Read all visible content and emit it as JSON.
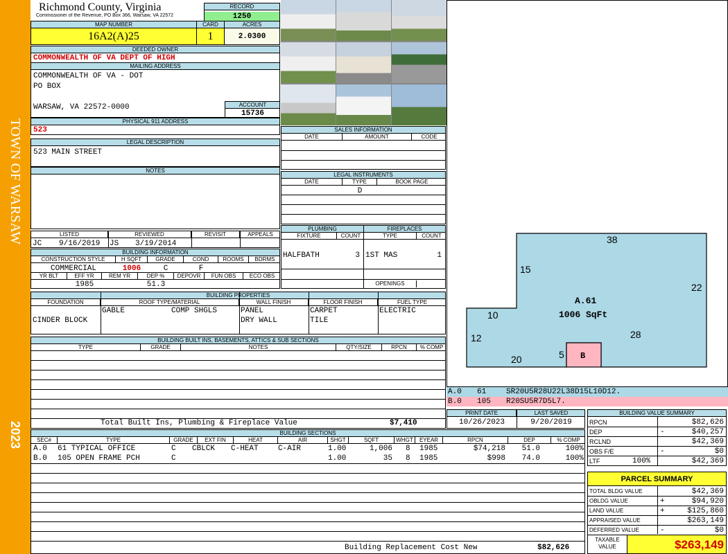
{
  "side_banner": {
    "town": "TOWN OF WARSAW",
    "year": "2023",
    "color": "#f5a000"
  },
  "header": {
    "county": "Richmond County, Virginia",
    "commissioner": "Commissioner of the Revenue, PO Box 366, Warsaw, VA 22572",
    "record_label": "RECORD",
    "record": "1250",
    "map_number_label": "MAP NUMBER",
    "map_number": "16A2(A)25",
    "card_label": "CARD",
    "card": "1",
    "acres_label": "ACRES",
    "acres": "2.0300"
  },
  "owner": {
    "label": "DEEDED OWNER",
    "value": "COMMONWEALTH OF VA DEPT OF HIGH"
  },
  "mailing": {
    "label": "MAILING ADDRESS",
    "line1": "COMMONWEALTH OF VA - DOT",
    "line2": "PO BOX",
    "line3": "WARSAW, VA 22572-0000",
    "account_label": "ACCOUNT",
    "account": "15736"
  },
  "physical": {
    "label": "PHYSICAL 911 ADDRESS",
    "value": "523"
  },
  "legal": {
    "label": "LEGAL DESCRIPTION",
    "value": "523 MAIN STREET"
  },
  "notes": {
    "label": "NOTES"
  },
  "listing": {
    "listed_label": "LISTED",
    "reviewed_label": "REVIEWED",
    "revisit_label": "REVISIT",
    "appeals_label": "APPEALS",
    "listed_by": "JC",
    "listed_date": "9/16/2019",
    "reviewed_by": "JS",
    "reviewed_date": "3/19/2014"
  },
  "building_info": {
    "label": "BUILDING INFORMATION",
    "headers": [
      "CONSTRUCTION STYLE",
      "H SQFT",
      "GRADE",
      "COND",
      "ROOMS",
      "BDRMS"
    ],
    "style": "COMMERCIAL",
    "hsqft": "1006",
    "grade": "C",
    "cond": "F",
    "headers2": [
      "YR BLT",
      "EFF YR",
      "REM YR",
      "DEP %",
      "DEPOVR",
      "FUN OBS",
      "ECO OBS"
    ],
    "eff_yr": "1985",
    "dep": "51.3"
  },
  "sales": {
    "label": "SALES INFORMATION",
    "headers": [
      "DATE",
      "AMOUNT",
      "CODE"
    ]
  },
  "instruments": {
    "label": "LEGAL INSTRUMENTS",
    "headers": [
      "DATE",
      "TYPE",
      "BOOK PAGE"
    ],
    "type": "D"
  },
  "plumbing": {
    "label": "PLUMBING",
    "headers": [
      "FIXTURE",
      "COUNT"
    ],
    "fixture": "HALFBATH",
    "count": "3"
  },
  "fireplaces": {
    "label": "FIREPLACES",
    "headers": [
      "TYPE",
      "COUNT"
    ],
    "type": "1ST MAS",
    "count": "1",
    "openings_label": "OPENINGS"
  },
  "properties": {
    "label": "BUILDING PROPERTIES",
    "headers": [
      "FOUNDATION",
      "ROOF TYPE/MATERIAL",
      "WALL FINISH",
      "FLOOR FINISH",
      "FUEL TYPE"
    ],
    "foundation": "CINDER BLOCK",
    "roof_type": "GABLE",
    "roof_material": "COMP SHGLS",
    "wall1": "PANEL",
    "wall2": "DRY WALL",
    "floor1": "CARPET",
    "floor2": "TILE",
    "fuel": "ELECTRIC"
  },
  "builtins": {
    "label": "BUILDING BUILT INS, BASEMENTS, ATTICS & SUB SECTIONS",
    "headers": [
      "TYPE",
      "GRADE",
      "NOTES",
      "QTY/SIZE",
      "RPCN",
      "% COMP"
    ],
    "total_label": "Total Built Ins, Plumbing & Fireplace Value",
    "total": "$7,410"
  },
  "dates": {
    "print_label": "PRINT DATE",
    "print": "10/26/2023",
    "saved_label": "LAST SAVED",
    "saved": "9/20/2019"
  },
  "sections": {
    "label": "BUILDING SECTIONS",
    "headers": [
      "SEC#",
      "TYPE",
      "GRADE",
      "EXT FIN",
      "HEAT",
      "AIR",
      "SHGT",
      "SQFT",
      "WHGT",
      "EYEAR",
      "RPCN",
      "DEP",
      "% COMP"
    ],
    "rows": [
      {
        "sec": "A.0",
        "type": "61 TYPICAL OFFICE",
        "grade": "C",
        "ext": "CBLCK",
        "heat": "C-HEAT",
        "air": "C-AIR",
        "shgt": "1.00",
        "sqft": "1,006",
        "whgt": "8",
        "eyear": "1985",
        "rpcn": "$74,218",
        "dep": "51.0",
        "comp": "100%"
      },
      {
        "sec": "B.0",
        "type": "105 OPEN FRAME PCH",
        "grade": "C",
        "ext": "",
        "heat": "",
        "air": "",
        "shgt": "1.00",
        "sqft": "35",
        "whgt": "8",
        "eyear": "1985",
        "rpcn": "$998",
        "dep": "74.0",
        "comp": "100%"
      }
    ],
    "replacement_label": "Building Replacement Cost New",
    "replacement": "$82,626"
  },
  "sketch": {
    "labels": {
      "top": "38",
      "left_upper": "15",
      "right": "22",
      "step": "10",
      "left_lower": "12",
      "bottom": "20",
      "porch_side": "5",
      "bottom_right": "28"
    },
    "area_name": "A.61",
    "area_sqft": "1006 SqFt",
    "porch": "B",
    "main_color": "#add8e6",
    "porch_color": "#ffb6c1",
    "legend": [
      {
        "sec": "A.0",
        "code": "61",
        "path": "SR20U5R28U22L38D15L10D12."
      },
      {
        "sec": "B.0",
        "code": "105",
        "path": "R20SU5R7D5L7."
      }
    ]
  },
  "value_summary": {
    "label": "BUILDING VALUE SUMMARY",
    "rows": [
      {
        "label": "RPCN",
        "sign": "",
        "pct": "",
        "value": "$82,626"
      },
      {
        "label": "DEP",
        "sign": "-",
        "pct": "",
        "value": "$40,257"
      },
      {
        "label": "RCLND",
        "sign": "",
        "pct": "",
        "value": "$42,369"
      },
      {
        "label": "OBS F/E",
        "sign": "-",
        "pct": "",
        "value": "$0"
      },
      {
        "label": "LTF",
        "sign": "",
        "pct": "100%",
        "value": "$42,369"
      }
    ]
  },
  "parcel_summary": {
    "label": "PARCEL SUMMARY",
    "rows": [
      {
        "label": "TOTAL BLDG VALUE",
        "sign": "",
        "value": "$42,369"
      },
      {
        "label": "OBLDG VALUE",
        "sign": "+",
        "value": "$94,920"
      },
      {
        "label": "LAND VALUE",
        "sign": "+",
        "value": "$125,860"
      },
      {
        "label": "APPRAISED VALUE",
        "sign": "",
        "value": "$263,149"
      },
      {
        "label": "DEFERRED VALUE",
        "sign": "-",
        "value": "$0"
      }
    ],
    "taxable_label": "TAXABLE VALUE",
    "taxable": "$263,149"
  }
}
